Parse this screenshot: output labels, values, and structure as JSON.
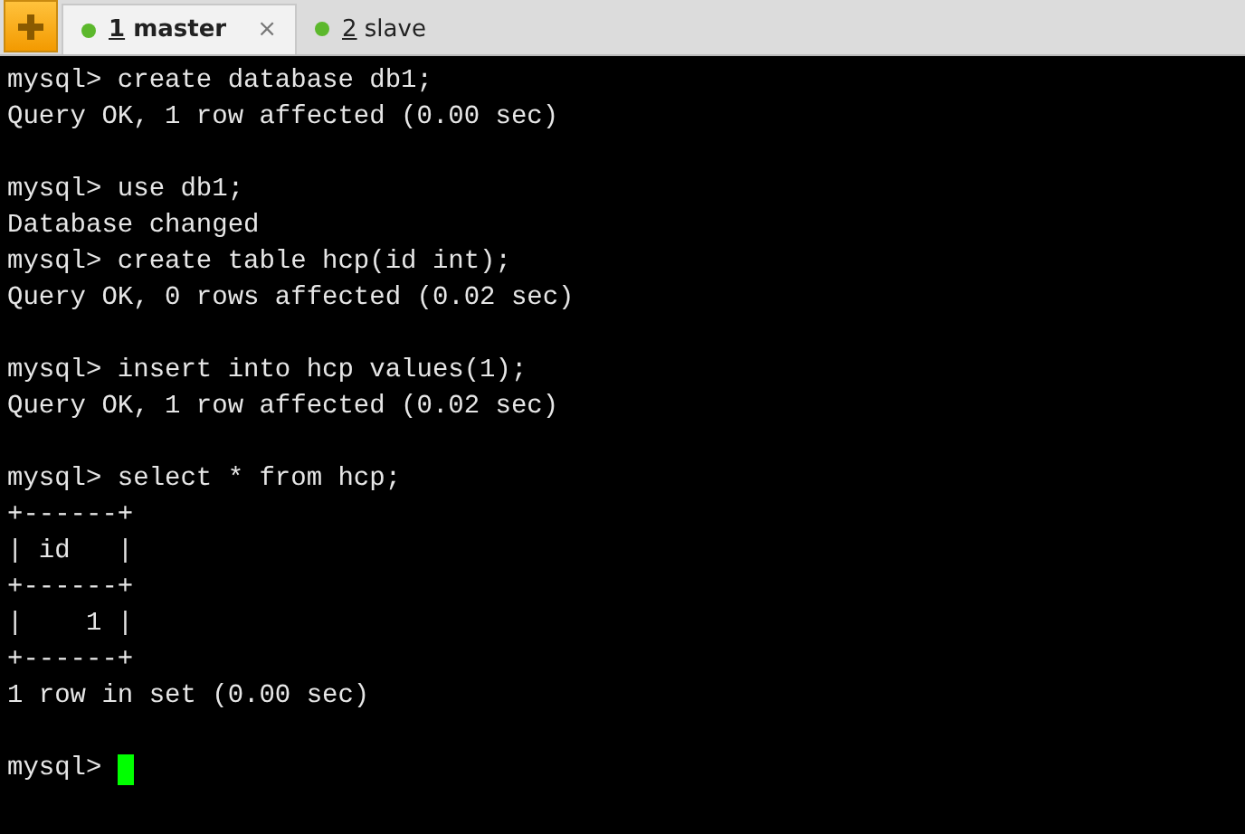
{
  "tabs": [
    {
      "number": "1",
      "name": "master",
      "selected": true,
      "color": "#5cb82c",
      "close": "×"
    },
    {
      "number": "2",
      "name": "slave",
      "selected": false,
      "color": "#5cb82c"
    }
  ],
  "terminal": {
    "blocks": [
      [
        "mysql> create database db1;",
        "Query OK, 1 row affected (0.00 sec)"
      ],
      [
        "mysql> use db1;",
        "Database changed",
        "mysql> create table hcp(id int);",
        "Query OK, 0 rows affected (0.02 sec)"
      ],
      [
        "mysql> insert into hcp values(1);",
        "Query OK, 1 row affected (0.02 sec)"
      ],
      [
        "mysql> select * from hcp;",
        "+------+",
        "| id   |",
        "+------+",
        "|    1 |",
        "+------+",
        "1 row in set (0.00 sec)"
      ],
      [
        "mysql> "
      ]
    ],
    "cursor": true
  }
}
